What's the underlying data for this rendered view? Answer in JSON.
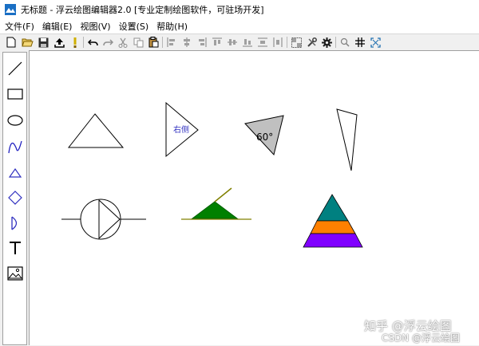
{
  "window": {
    "title": "无标题 - 浮云绘图编辑器2.0 [专业定制绘图软件，可驻场开发]"
  },
  "menu": [
    {
      "id": "file",
      "label": "文件(F)"
    },
    {
      "id": "edit",
      "label": "编辑(E)"
    },
    {
      "id": "view",
      "label": "视图(V)"
    },
    {
      "id": "settings",
      "label": "设置(S)"
    },
    {
      "id": "help",
      "label": "帮助(H)"
    }
  ],
  "toolbar_icons": [
    "new-file-icon",
    "open-folder-icon",
    "save-icon",
    "export-icon",
    "alert-icon",
    "undo-icon",
    "redo-icon",
    "cut-icon",
    "copy-icon",
    "paste-icon",
    "align-left-icon",
    "align-center-icon",
    "align-right-icon",
    "align-top-icon",
    "align-middle-icon",
    "align-bottom-icon",
    "distribute-h-icon",
    "distribute-v-icon",
    "group-icon",
    "tools-icon",
    "settings-gear-icon",
    "zoom-icon",
    "grid-icon",
    "fit-screen-icon"
  ],
  "left_tools": [
    "line-tool-icon",
    "rectangle-tool-icon",
    "ellipse-tool-icon",
    "polyline-tool-icon",
    "triangle-tool-icon",
    "diamond-tool-icon",
    "arc-tool-icon",
    "text-tool-icon",
    "image-tool-icon"
  ],
  "canvas": {
    "triangle_label": "右侧",
    "angle_label": "60°",
    "colors": {
      "grey_fill": "#c0c0c0",
      "green_fill": "#008000",
      "olive_line": "#808000",
      "teal": "#008080",
      "orange": "#ff8000",
      "purple": "#8000ff",
      "label_blue": "#3030c0"
    }
  },
  "watermark": {
    "line1": "知乎 @浮云绘图",
    "line2": "CSDN @浮云绘图"
  }
}
